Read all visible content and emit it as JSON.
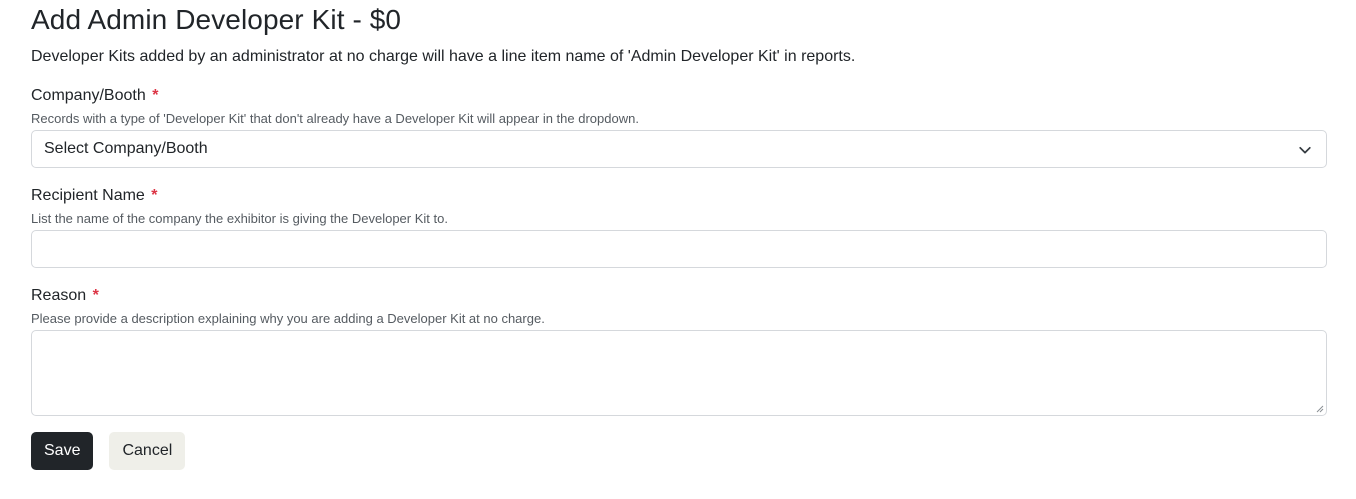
{
  "page": {
    "title": "Add Admin Developer Kit - $0",
    "intro": "Developer Kits added by an administrator at no charge will have a line item name of 'Admin Developer Kit' in reports."
  },
  "fields": {
    "company": {
      "label": "Company/Booth",
      "required_mark": "*",
      "help": "Records with a type of 'Developer Kit' that don't already have a Developer Kit will appear in the dropdown.",
      "selected": "Select Company/Booth"
    },
    "recipient": {
      "label": "Recipient Name",
      "required_mark": "*",
      "help": "List the name of the company the exhibitor is giving the Developer Kit to.",
      "value": ""
    },
    "reason": {
      "label": "Reason",
      "required_mark": "*",
      "help": "Please provide a description explaining why you are adding a Developer Kit at no charge.",
      "value": ""
    }
  },
  "actions": {
    "save_label": "Save",
    "cancel_label": "Cancel"
  },
  "colors": {
    "required": "#dc3545",
    "primary_button": "#212529",
    "secondary_button": "#efefe9"
  },
  "icons": {
    "select_arrow": "chevron-down-icon",
    "textarea_resize": "resize-grip-icon"
  }
}
